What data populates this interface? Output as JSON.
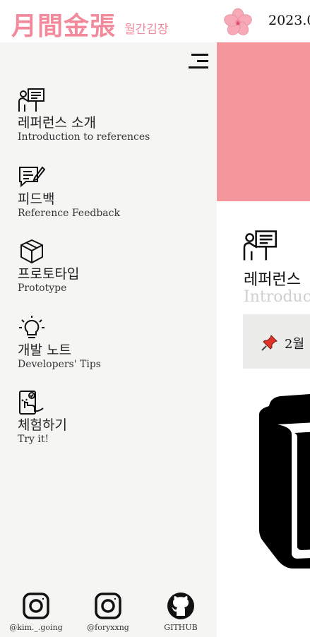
{
  "header": {
    "logo_main": "月間金張",
    "logo_sub": "월간김장",
    "date": "2023.0"
  },
  "sidebar": {
    "items": [
      {
        "icon": "presentation-icon",
        "title": "레퍼런스 소개",
        "subtitle": "Introduction to references"
      },
      {
        "icon": "feedback-icon",
        "title": "피드백",
        "subtitle": "Reference Feedback"
      },
      {
        "icon": "cube-icon",
        "title": "프로토타입",
        "subtitle": "Prototype"
      },
      {
        "icon": "lightbulb-icon",
        "title": "개발 노트",
        "subtitle": "Developers' Tips"
      },
      {
        "icon": "tablet-touch-icon",
        "title": "체험하기",
        "subtitle": "Try it!"
      }
    ],
    "socials": [
      {
        "icon": "instagram-icon",
        "label": "@kim._.going"
      },
      {
        "icon": "instagram-icon",
        "label": "@foryxxng"
      },
      {
        "icon": "github-icon",
        "label": "GITHUB"
      }
    ]
  },
  "main": {
    "section_title": "레퍼런스",
    "section_subtitle": "Introducti",
    "notice_text": "2월",
    "colors": {
      "hero": "#f5959c",
      "brand": "#f28a9c"
    }
  }
}
